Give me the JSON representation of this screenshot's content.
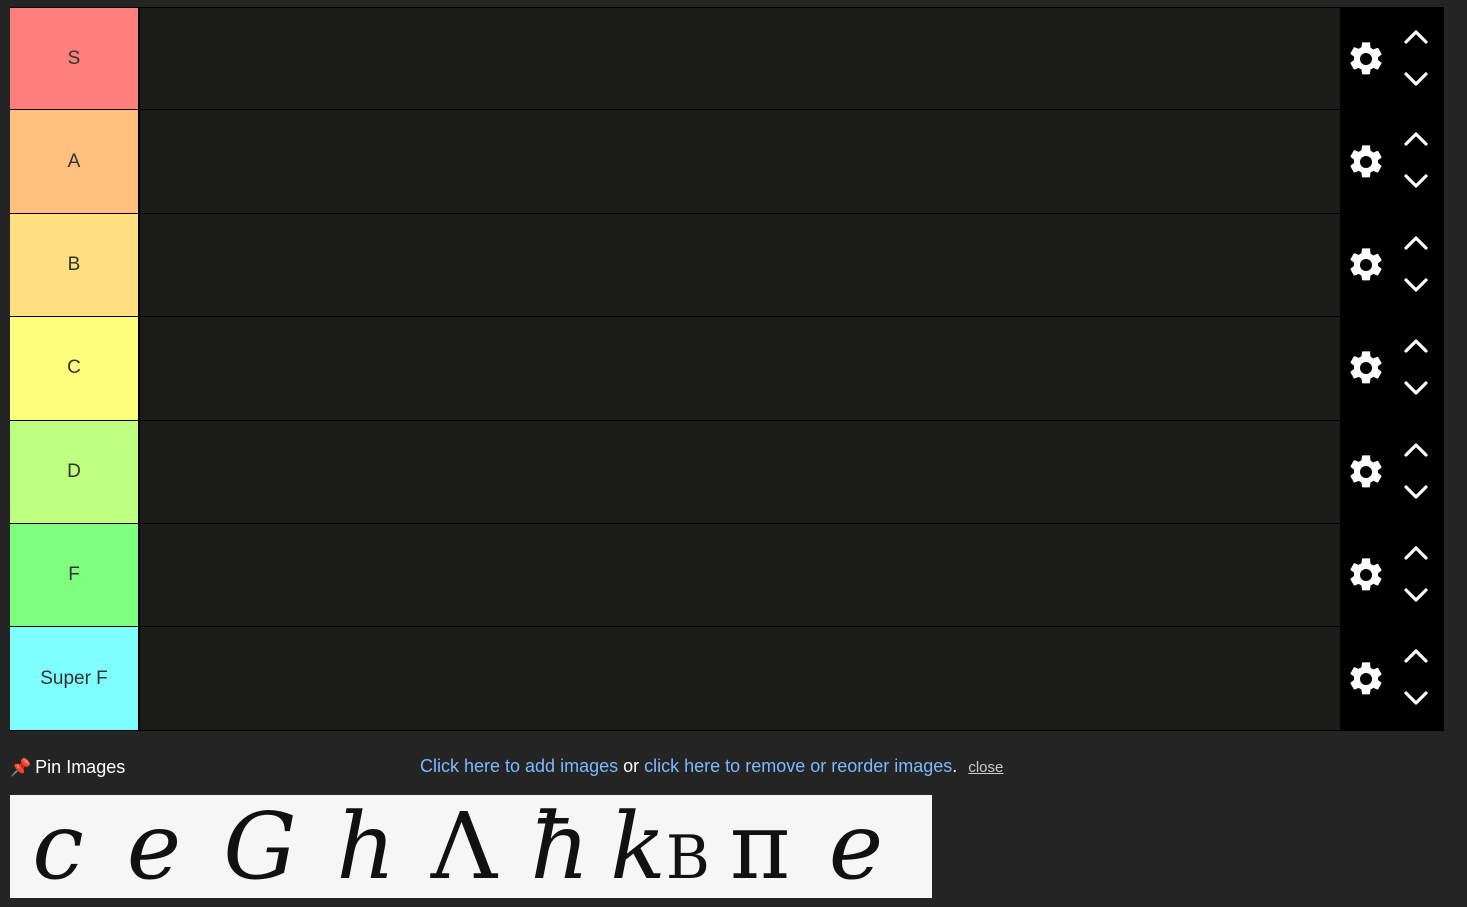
{
  "tiers": [
    {
      "label": "S",
      "color": "#ff7f7f"
    },
    {
      "label": "A",
      "color": "#ffbf7f"
    },
    {
      "label": "B",
      "color": "#ffdf7f"
    },
    {
      "label": "C",
      "color": "#ffff7f"
    },
    {
      "label": "D",
      "color": "#bfff7f"
    },
    {
      "label": "F",
      "color": "#7fff7f"
    },
    {
      "label": "Super F",
      "color": "#7fffff"
    }
  ],
  "bottom": {
    "pin_label": "Pin Images",
    "add_images": "Click here to add images",
    "or": "or",
    "remove_reorder": "click here to remove or reorder images",
    "period": ".",
    "close": "close"
  },
  "images": [
    {
      "name": "speed-of-light-c",
      "main": "c",
      "sub": ""
    },
    {
      "name": "elementary-charge-e",
      "main": "e",
      "sub": ""
    },
    {
      "name": "gravitational-constant-G",
      "main": "G",
      "sub": ""
    },
    {
      "name": "planck-constant-h",
      "main": "h",
      "sub": ""
    },
    {
      "name": "cosmological-constant-lambda",
      "main": "Λ",
      "sub": ""
    },
    {
      "name": "reduced-planck-hbar",
      "main": "ħ",
      "sub": ""
    },
    {
      "name": "boltzmann-constant-kb",
      "main": "k",
      "sub": "B"
    },
    {
      "name": "pi",
      "main": "π",
      "sub": ""
    },
    {
      "name": "euler-number-e",
      "main": "e",
      "sub": ""
    }
  ],
  "icons": {
    "gear": "gear-icon",
    "up": "chevron-up-icon",
    "down": "chevron-down-icon",
    "pin": "pushpin-icon"
  }
}
